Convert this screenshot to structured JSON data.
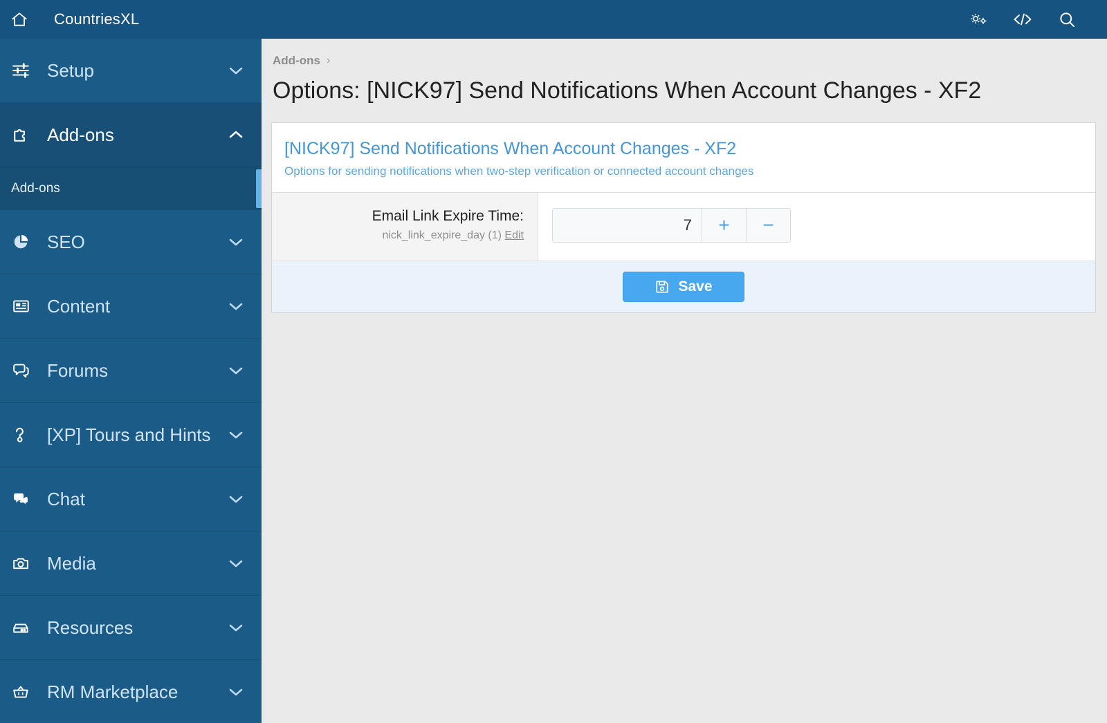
{
  "topbar": {
    "home_icon": "home-icon",
    "brand": "CountriesXL",
    "icons": [
      {
        "name": "gears-icon",
        "label": "Tools"
      },
      {
        "name": "code-icon",
        "label": "Development"
      },
      {
        "name": "search-icon",
        "label": "Search"
      }
    ]
  },
  "sidebar": {
    "items": [
      {
        "label": "Setup",
        "icon": "sliders-icon",
        "expanded": false,
        "chevron": "chevron-down-icon"
      },
      {
        "label": "Add-ons",
        "icon": "puzzle-piece-icon",
        "expanded": true,
        "chevron": "chevron-up-icon",
        "children": [
          {
            "label": "Add-ons",
            "active": true
          }
        ]
      },
      {
        "label": "SEO",
        "icon": "pie-chart-icon",
        "expanded": false,
        "chevron": "chevron-down-icon"
      },
      {
        "label": "Content",
        "icon": "newspaper-icon",
        "expanded": false,
        "chevron": "chevron-down-icon"
      },
      {
        "label": "Forums",
        "icon": "comments-icon",
        "expanded": false,
        "chevron": "chevron-down-icon"
      },
      {
        "label": "[XP] Tours and Hints",
        "icon": "question-mark-icon",
        "expanded": false,
        "chevron": "chevron-down-icon"
      },
      {
        "label": "Chat",
        "icon": "chat-bubbles-icon",
        "expanded": false,
        "chevron": "chevron-down-icon"
      },
      {
        "label": "Media",
        "icon": "camera-icon",
        "expanded": false,
        "chevron": "chevron-down-icon"
      },
      {
        "label": "Resources",
        "icon": "box-icon",
        "expanded": false,
        "chevron": "chevron-down-icon"
      },
      {
        "label": "RM Marketplace",
        "icon": "basket-icon",
        "expanded": false,
        "chevron": "chevron-down-icon"
      }
    ]
  },
  "main": {
    "breadcrumb": {
      "link": "Add-ons",
      "separator": "›"
    },
    "page_title": "Options: [NICK97] Send Notifications When Account Changes - XF2",
    "card": {
      "title": "[NICK97] Send Notifications When Account Changes - XF2",
      "subtitle": "Options for sending notifications when two-step verification or connected account changes",
      "rows": [
        {
          "label": "Email Link Expire Time:",
          "hint": "nick_link_expire_day (1)",
          "edit_link": "Edit",
          "value": "7",
          "increment_label": "+",
          "decrement_label": "−"
        }
      ],
      "save_label": "Save",
      "save_icon": "floppy-disk-icon"
    }
  },
  "colors": {
    "topbar": "#175380",
    "sidebar": "#1a5b88",
    "sidebar_expanded": "#174f76",
    "sidebar_sub": "#154b71",
    "active_accent": "#63b3e8",
    "card_title": "#4695d6",
    "save_button": "#47a8ef",
    "footer": "#eaf3fc"
  }
}
